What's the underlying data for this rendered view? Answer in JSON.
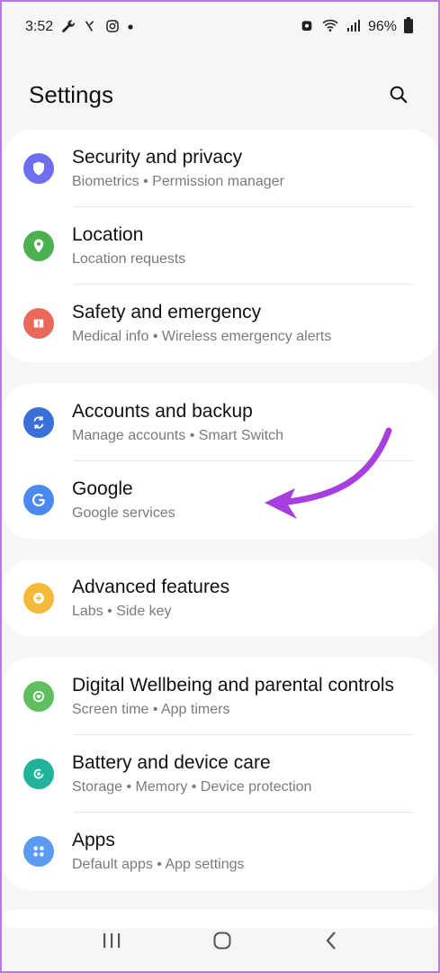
{
  "status_bar": {
    "time": "3:52",
    "battery": "96%"
  },
  "header": {
    "title": "Settings"
  },
  "groups": [
    {
      "items": [
        {
          "title": "Security and privacy",
          "subtitle": "Biometrics  •  Permission manager",
          "icon": "shield-icon",
          "color": "#6e6ef0"
        },
        {
          "title": "Location",
          "subtitle": "Location requests",
          "icon": "location-pin-icon",
          "color": "#4caf50"
        },
        {
          "title": "Safety and emergency",
          "subtitle": "Medical info  •  Wireless emergency alerts",
          "icon": "alert-icon",
          "color": "#e8695a"
        }
      ]
    },
    {
      "items": [
        {
          "title": "Accounts and backup",
          "subtitle": "Manage accounts  •  Smart Switch",
          "icon": "sync-icon",
          "color": "#3a6fd8"
        },
        {
          "title": "Google",
          "subtitle": "Google services",
          "icon": "google-icon",
          "color": "#4a8af0"
        }
      ]
    },
    {
      "items": [
        {
          "title": "Advanced features",
          "subtitle": "Labs  •  Side key",
          "icon": "gear-plus-icon",
          "color": "#f5b93a"
        }
      ]
    },
    {
      "items": [
        {
          "title": "Digital Wellbeing and parental controls",
          "subtitle": "Screen time  •  App timers",
          "icon": "wellbeing-icon",
          "color": "#5fbf5f"
        },
        {
          "title": "Battery and device care",
          "subtitle": "Storage  •  Memory  •  Device protection",
          "icon": "device-care-icon",
          "color": "#20b39a"
        },
        {
          "title": "Apps",
          "subtitle": "Default apps  •  App settings",
          "icon": "apps-grid-icon",
          "color": "#5b9af0"
        }
      ]
    }
  ],
  "annotation_color": "#a63fe0"
}
